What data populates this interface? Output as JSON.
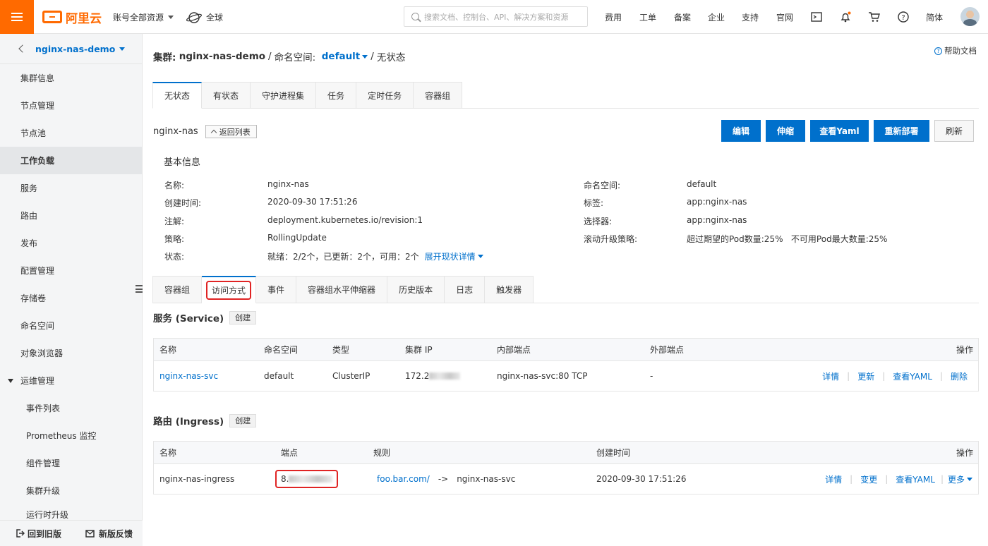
{
  "topbar": {
    "logo_text": "阿里云",
    "account_scope": "账号全部资源",
    "region": "全球",
    "search_placeholder": "搜索文档、控制台、API、解决方案和资源",
    "nav": [
      "费用",
      "工单",
      "备案",
      "企业",
      "支持",
      "官网"
    ],
    "lang": "简体",
    "brand_color": "#ff6a00"
  },
  "sidebar": {
    "cluster": "nginx-nas-demo",
    "items": [
      {
        "label": "集群信息"
      },
      {
        "label": "节点管理"
      },
      {
        "label": "节点池"
      },
      {
        "label": "工作负载",
        "active": true
      },
      {
        "label": "服务"
      },
      {
        "label": "路由"
      },
      {
        "label": "发布"
      },
      {
        "label": "配置管理"
      },
      {
        "label": "存储卷"
      },
      {
        "label": "命名空间"
      },
      {
        "label": "对象浏览器"
      },
      {
        "label": "运维管理",
        "expanded": true
      }
    ],
    "sub_items": [
      {
        "label": "事件列表"
      },
      {
        "label": "Prometheus 监控"
      },
      {
        "label": "组件管理"
      },
      {
        "label": "集群升级"
      },
      {
        "label": "运行时升级"
      }
    ],
    "footer": {
      "old_version": "回到旧版",
      "feedback": "新版反馈"
    }
  },
  "breadcrumb": {
    "cluster_label": "集群:",
    "cluster_name": "nginx-nas-demo",
    "sep1": "/",
    "namespace_label": "命名空间:",
    "namespace": "default",
    "sep2": "/",
    "current": "无状态"
  },
  "help_docs": "帮助文档",
  "workload_tabs": [
    "无状态",
    "有状态",
    "守护进程集",
    "任务",
    "定时任务",
    "容器组"
  ],
  "deployment": {
    "name": "nginx-nas",
    "back_label": "返回列表",
    "actions": {
      "edit": "编辑",
      "scale": "伸缩",
      "yaml": "查看Yaml",
      "redeploy": "重新部署",
      "refresh": "刷新"
    }
  },
  "basic_info": {
    "title": "基本信息",
    "left": [
      {
        "k": "名称:",
        "v": "nginx-nas"
      },
      {
        "k": "创建时间:",
        "v": "2020-09-30 17:51:26"
      },
      {
        "k": "注解:",
        "v": "deployment.kubernetes.io/revision:1"
      },
      {
        "k": "策略:",
        "v": "RollingUpdate"
      },
      {
        "k": "状态:",
        "v": "就绪：2/2个，已更新：2个，可用：2个"
      }
    ],
    "expand_label": "展开现状详情",
    "right": [
      {
        "k": "命名空间:",
        "v": "default"
      },
      {
        "k": "标签:",
        "v": "app:nginx-nas"
      },
      {
        "k": "选择器:",
        "v": "app:nginx-nas"
      },
      {
        "k": "滚动升级策略:",
        "v": "超过期望的Pod数量:25%   不可用Pod最大数量:25%"
      }
    ]
  },
  "detail_tabs": [
    "容器组",
    "访问方式",
    "事件",
    "容器组水平伸缩器",
    "历史版本",
    "日志",
    "触发器"
  ],
  "service_section": {
    "title": "服务 (Service)",
    "create": "创建",
    "headers": [
      "名称",
      "命名空间",
      "类型",
      "集群 IP",
      "内部端点",
      "外部端点",
      "操作"
    ],
    "rows": [
      {
        "name": "nginx-nas-svc",
        "namespace": "default",
        "type": "ClusterIP",
        "cluster_ip": "172.2",
        "internal": "nginx-nas-svc:80 TCP",
        "external": "-",
        "ops": [
          "详情",
          "更新",
          "查看YAML",
          "删除"
        ]
      }
    ]
  },
  "ingress_section": {
    "title": "路由 (Ingress)",
    "create": "创建",
    "headers": [
      "名称",
      "端点",
      "规则",
      "创建时间",
      "操作"
    ],
    "rows": [
      {
        "name": "nginx-nas-ingress",
        "endpoint": "8.",
        "rule_host": "foo.bar.com/",
        "rule_arrow": "->",
        "rule_target": "nginx-nas-svc",
        "created": "2020-09-30 17:51:26",
        "ops": [
          "详情",
          "变更",
          "查看YAML",
          "更多"
        ]
      }
    ]
  }
}
